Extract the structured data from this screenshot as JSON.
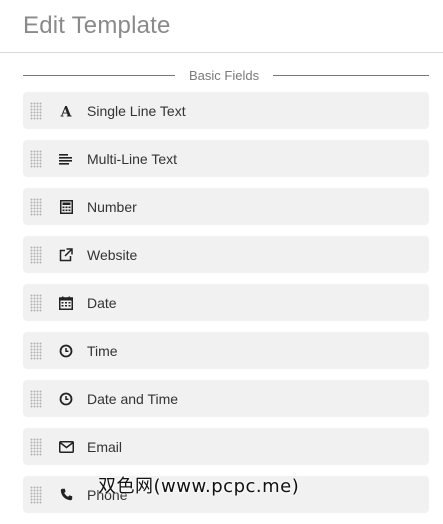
{
  "header": {
    "title": "Edit Template"
  },
  "section": {
    "label": "Basic Fields",
    "fields": [
      {
        "label": "Single Line Text",
        "icon": "font-letter-a-icon"
      },
      {
        "label": "Multi-Line Text",
        "icon": "align-left-lines-icon"
      },
      {
        "label": "Number",
        "icon": "calculator-icon"
      },
      {
        "label": "Website",
        "icon": "external-link-icon"
      },
      {
        "label": "Date",
        "icon": "calendar-icon"
      },
      {
        "label": "Time",
        "icon": "clock-icon"
      },
      {
        "label": "Date and Time",
        "icon": "clock-icon"
      },
      {
        "label": "Email",
        "icon": "envelope-icon"
      },
      {
        "label": "Phone",
        "icon": "phone-icon"
      }
    ]
  },
  "watermark": {
    "text": "双色网(www.pcpc.me)"
  }
}
